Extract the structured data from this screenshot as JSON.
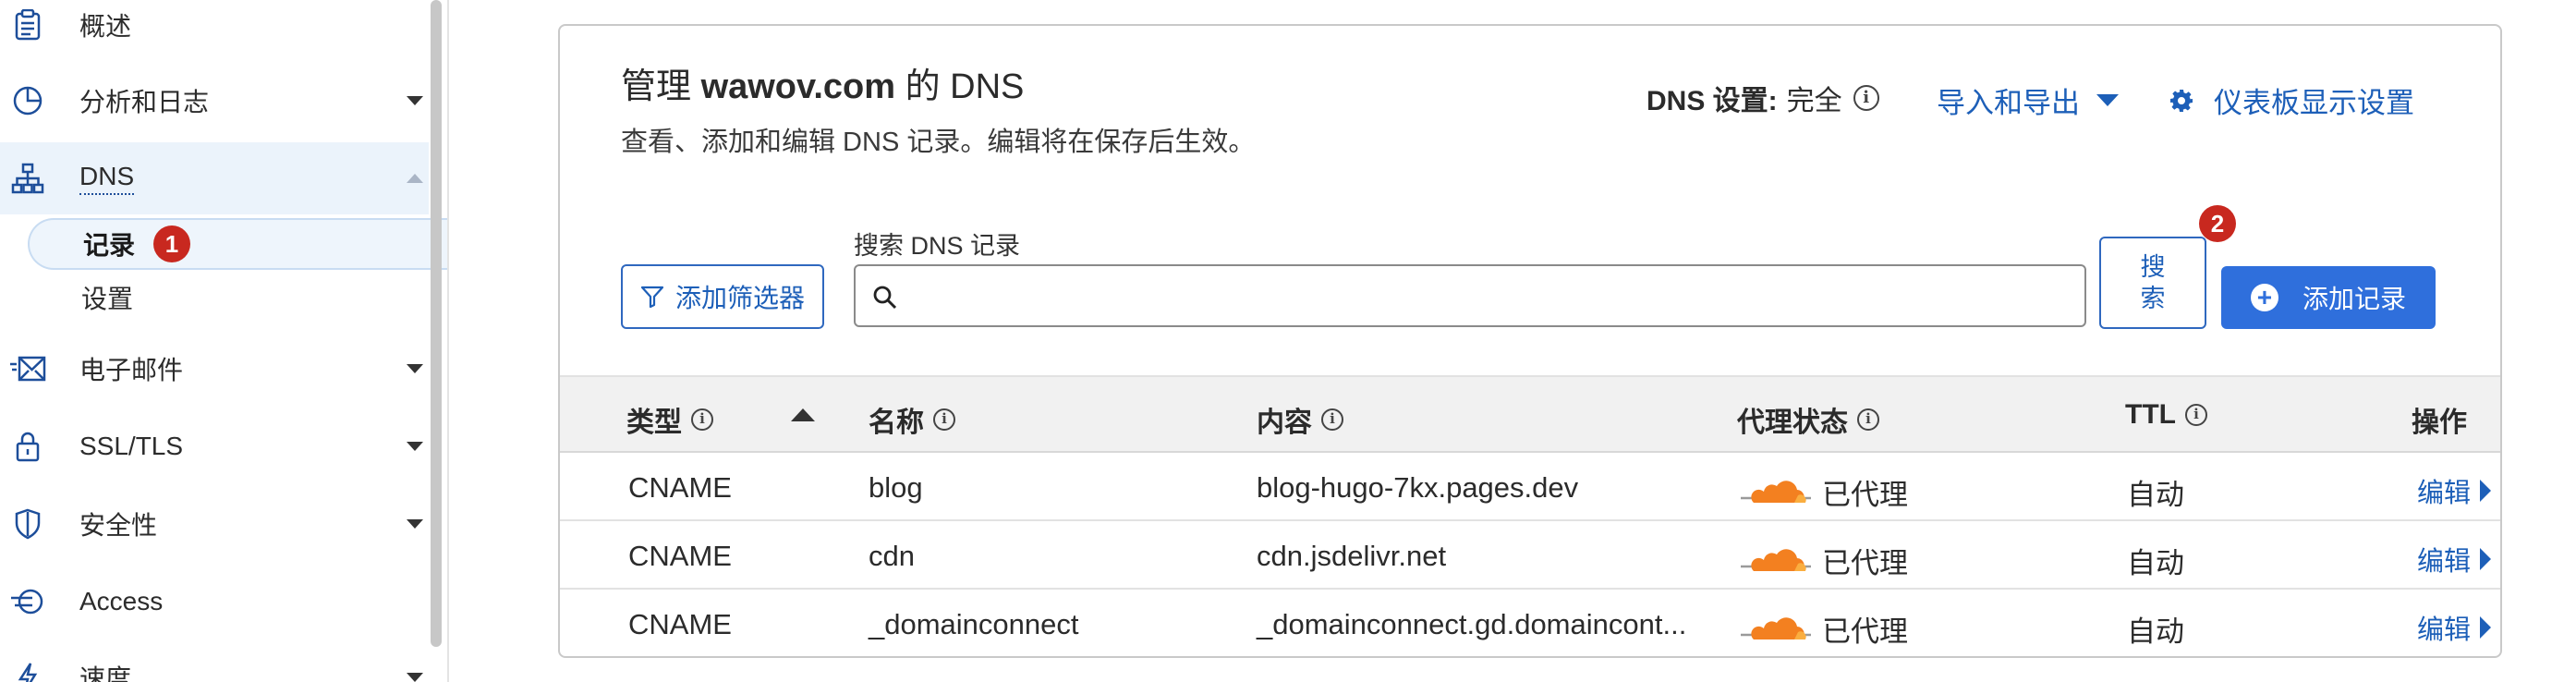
{
  "sidebar": {
    "items": [
      {
        "label": "概述",
        "icon": "clipboard-icon"
      },
      {
        "label": "分析和日志",
        "icon": "pie-chart-icon"
      },
      {
        "label": "DNS",
        "icon": "sitemap-icon"
      },
      {
        "label": "电子邮件",
        "icon": "mail-icon"
      },
      {
        "label": "SSL/TLS",
        "icon": "lock-icon"
      },
      {
        "label": "安全性",
        "icon": "shield-icon"
      },
      {
        "label": "Access",
        "icon": "access-icon"
      },
      {
        "label": "速度",
        "icon": "bolt-icon"
      }
    ],
    "dns_sub": [
      {
        "label": "记录",
        "badge": "1"
      },
      {
        "label": "设置"
      }
    ]
  },
  "header": {
    "title_prefix": "管理 ",
    "title_domain": "wawov.com",
    "title_suffix": " 的 DNS",
    "subtitle": "查看、添加和编辑 DNS 记录。编辑将在保存后生效。",
    "dns_setting_label": "DNS 设置:",
    "dns_setting_value": "完全",
    "import_export": "导入和导出",
    "dashboard_settings": "仪表板显示设置"
  },
  "toolbar": {
    "filter_button": "添加筛选器",
    "search_label": "搜索 DNS 记录",
    "search_placeholder": "",
    "search_button": "搜索",
    "add_button": "添加记录",
    "add_badge": "2"
  },
  "table": {
    "columns": [
      "类型",
      "名称",
      "内容",
      "代理状态",
      "TTL",
      "操作"
    ],
    "rows": [
      {
        "type": "CNAME",
        "name": "blog",
        "content": "blog-hugo-7kx.pages.dev",
        "proxy": "已代理",
        "ttl": "自动",
        "action": "编辑"
      },
      {
        "type": "CNAME",
        "name": "cdn",
        "content": "cdn.jsdelivr.net",
        "proxy": "已代理",
        "ttl": "自动",
        "action": "编辑"
      },
      {
        "type": "CNAME",
        "name": "_domainconnect",
        "content": "_domainconnect.gd.domaincont...",
        "proxy": "已代理",
        "ttl": "自动",
        "action": "编辑"
      }
    ]
  },
  "colors": {
    "accent": "#2f6fdc",
    "link": "#1d5fb8",
    "badge": "#c8281f",
    "cloud": "#f38020"
  }
}
